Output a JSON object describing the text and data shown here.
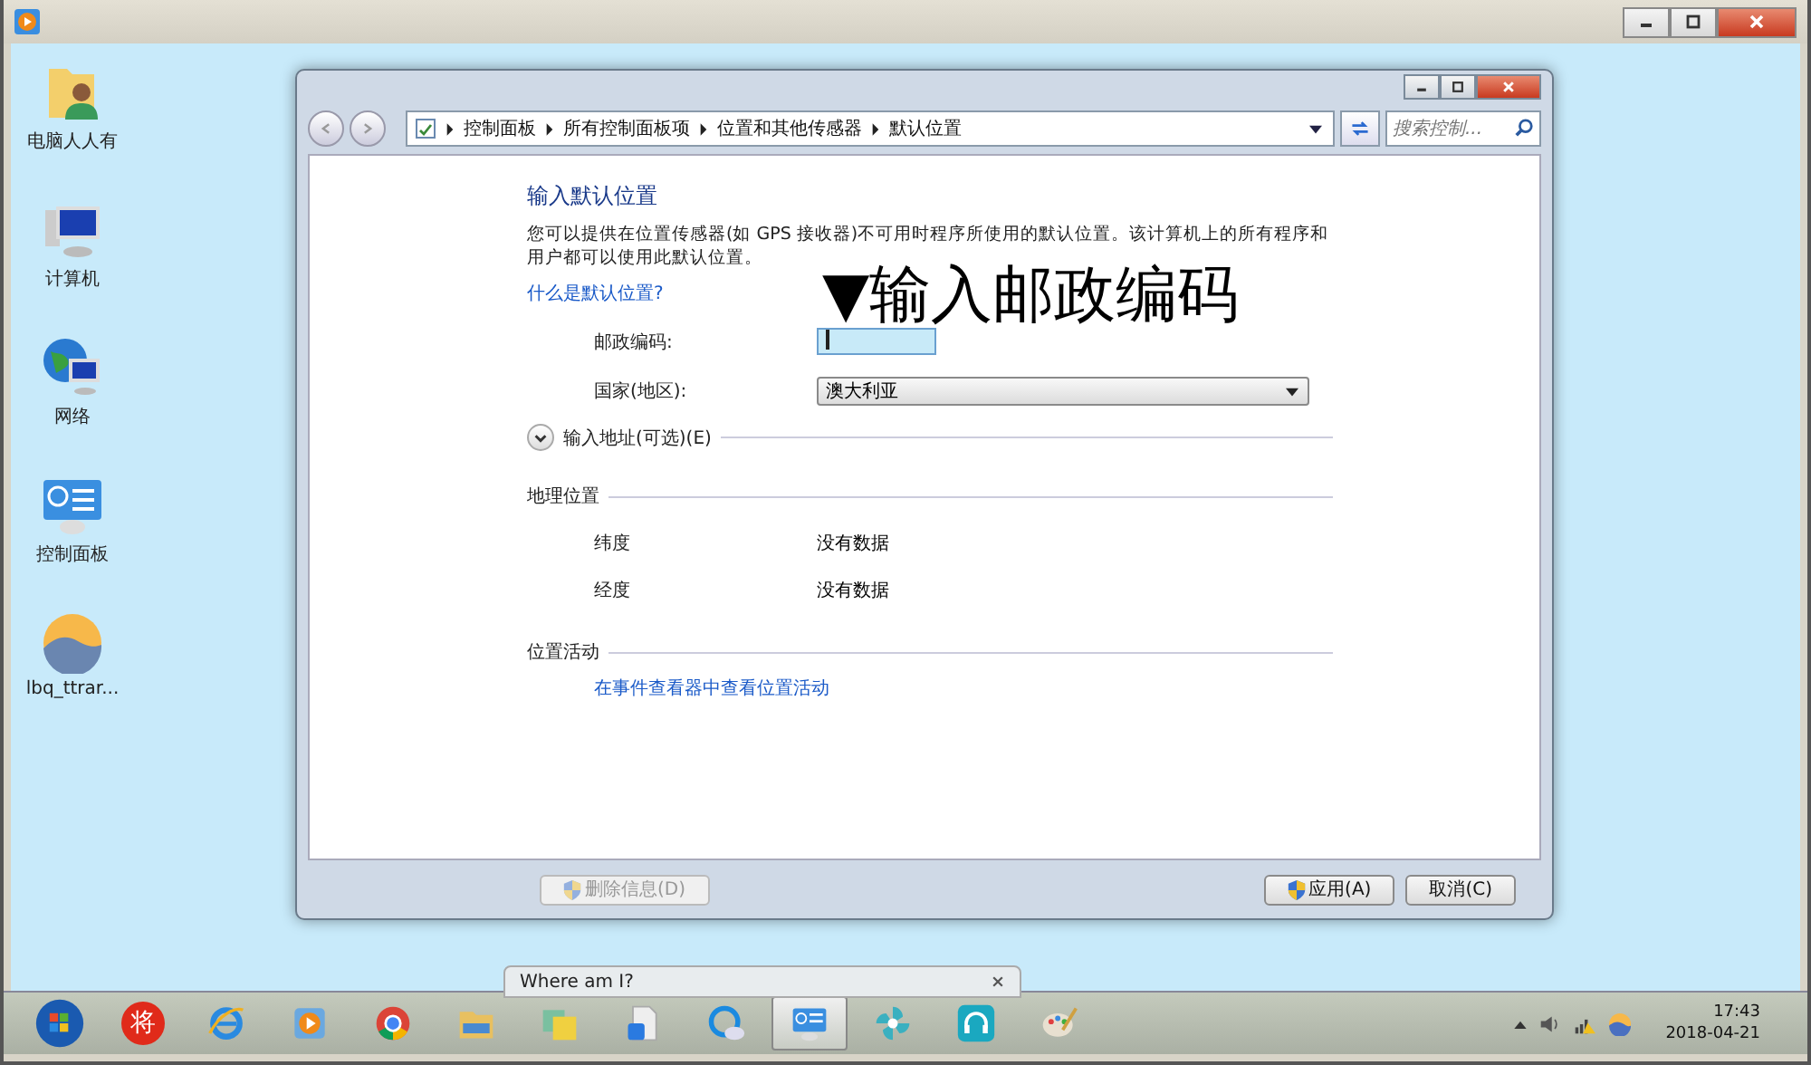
{
  "desktop_icons": [
    {
      "kind": "user-folder",
      "label": "电脑人人有"
    },
    {
      "kind": "computer",
      "label": "计算机"
    },
    {
      "kind": "network",
      "label": "网络"
    },
    {
      "kind": "control-panel",
      "label": "控制面板"
    },
    {
      "kind": "photo-app",
      "label": "lbq_ttrar..."
    }
  ],
  "window": {
    "breadcrumb": [
      "控制面板",
      "所有控制面板项",
      "位置和其他传感器",
      "默认位置"
    ],
    "search": {
      "placeholder": "搜索控制..."
    },
    "heading": "输入默认位置",
    "description": "您可以提供在位置传感器(如 GPS 接收器)不可用时程序所使用的默认位置。该计算机上的所有程序和用户都可以使用此默认位置。",
    "help_link": "什么是默认位置?",
    "fields": [
      {
        "kind": "text",
        "label": "邮政编码:",
        "focused": true
      },
      {
        "kind": "select",
        "label": "国家(地区):",
        "value": "澳大利亚"
      }
    ],
    "expander": {
      "label": "输入地址(可选)(E)",
      "expanded": false
    },
    "geo_section": {
      "title": "地理位置",
      "rows": [
        {
          "label": "纬度",
          "value": "没有数据"
        },
        {
          "label": "经度",
          "value": "没有数据"
        }
      ]
    },
    "activity_section": {
      "title": "位置活动",
      "link": "在事件查看器中查看位置活动"
    },
    "buttons": [
      {
        "label": "删除信息(D)",
        "disabled": true,
        "shield": true
      },
      {
        "label": "应用(A)",
        "disabled": false,
        "shield": true
      },
      {
        "label": "取消(C)",
        "disabled": false,
        "shield": false
      }
    ]
  },
  "annotation": "▼输入邮政编码",
  "taskbar": {
    "items": [
      {
        "kind": "start",
        "selected": false
      },
      {
        "kind": "badge",
        "text": "将",
        "selected": false
      },
      {
        "kind": "browser-e",
        "selected": false
      },
      {
        "kind": "player",
        "selected": false
      },
      {
        "kind": "chrome",
        "selected": false
      },
      {
        "kind": "folder",
        "selected": false
      },
      {
        "kind": "notes",
        "selected": false
      },
      {
        "kind": "file",
        "selected": false
      },
      {
        "kind": "cloud",
        "selected": false
      },
      {
        "kind": "control-panel",
        "selected": true
      },
      {
        "kind": "pinwheel",
        "selected": false
      },
      {
        "kind": "headphones",
        "selected": false
      },
      {
        "kind": "paint",
        "selected": false
      }
    ],
    "preview_title": "Where am I?",
    "time": "17:43",
    "date": "2018-04-21"
  }
}
